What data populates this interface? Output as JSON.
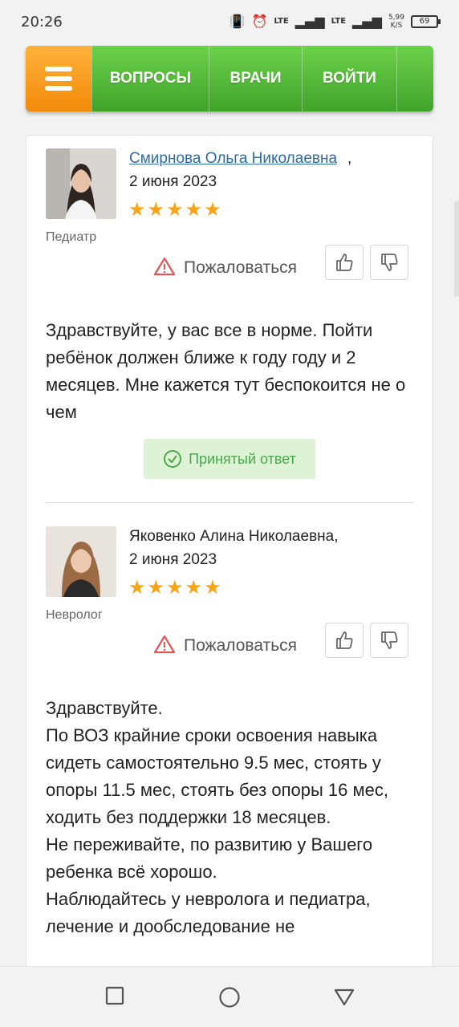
{
  "status_bar": {
    "time": "20:26",
    "network_1": "LTE",
    "network_2": "LTE",
    "speed_value": "5,99",
    "speed_unit": "K/S",
    "battery": "69"
  },
  "navbar": {
    "items": [
      {
        "label": "ВОПРОСЫ"
      },
      {
        "label": "ВРАЧИ"
      },
      {
        "label": "ВОЙТИ"
      }
    ],
    "colors": {
      "green": "#4cb832",
      "orange": "#f59a1c"
    }
  },
  "answers": [
    {
      "doctor_name": "Смирнова Ольга Николаевна",
      "name_suffix": ",",
      "date": "2 июня 2023",
      "rating": 5,
      "specialty": "Педиатр",
      "complain_label": "Пожаловаться",
      "text": "Здравствуйте, у вас все в норме. Пойти ребёнок должен ближе к году году и 2 месяцев. Мне кажется тут беспокоится не о чем",
      "accepted_label": "Принятый ответ"
    },
    {
      "doctor_name": "Яковенко Алина Николаевна,",
      "date": "2 июня 2023",
      "rating": 5,
      "specialty": "Невролог",
      "complain_label": "Пожаловаться",
      "text_lines": [
        "Здравствуйте.",
        "По ВОЗ крайние сроки освоения навыка сидеть самостоятельно 9.5 мес, стоять у опоры 11.5 мес, стоять без опоры 16 мес, ходить без поддержки 18 месяцев.",
        "Не переживайте, по развитию у Вашего ребенка всё хорошо.",
        "Наблюдайтесь у невролога и педиатра, лечение и дообследование не"
      ]
    }
  ],
  "icons": {
    "menu": "hamburger-icon",
    "warning": "warning-triangle-icon",
    "like": "thumbs-up-icon",
    "dislike": "thumbs-down-icon",
    "accepted": "check-circle-icon",
    "star": "star-icon"
  }
}
